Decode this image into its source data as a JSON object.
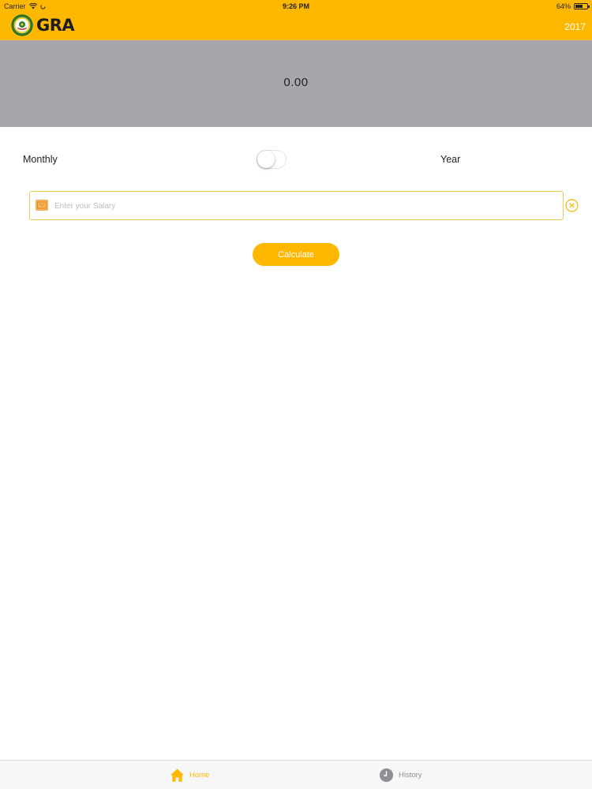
{
  "status_bar": {
    "carrier": "Carrier",
    "time": "9:26 PM",
    "battery_percent": "64%",
    "battery_level": 0.64
  },
  "header": {
    "logo_text": "GRA",
    "year": "2017",
    "background_color": "#FFB800"
  },
  "result": {
    "value": "0.00",
    "background_color": "#A7A6AA"
  },
  "period_toggle": {
    "left_label": "Monthly",
    "right_label": "Year",
    "is_on": false
  },
  "salary_input": {
    "placeholder": "Enter your Salary",
    "value": ""
  },
  "calculate_button": {
    "label": "Calculate"
  },
  "tab_bar": {
    "tabs": [
      {
        "label": "Home",
        "icon": "home-icon",
        "active": true
      },
      {
        "label": "History",
        "icon": "clock-icon",
        "active": false
      }
    ],
    "active_color": "#FFB800",
    "inactive_color": "#8E8E93"
  }
}
